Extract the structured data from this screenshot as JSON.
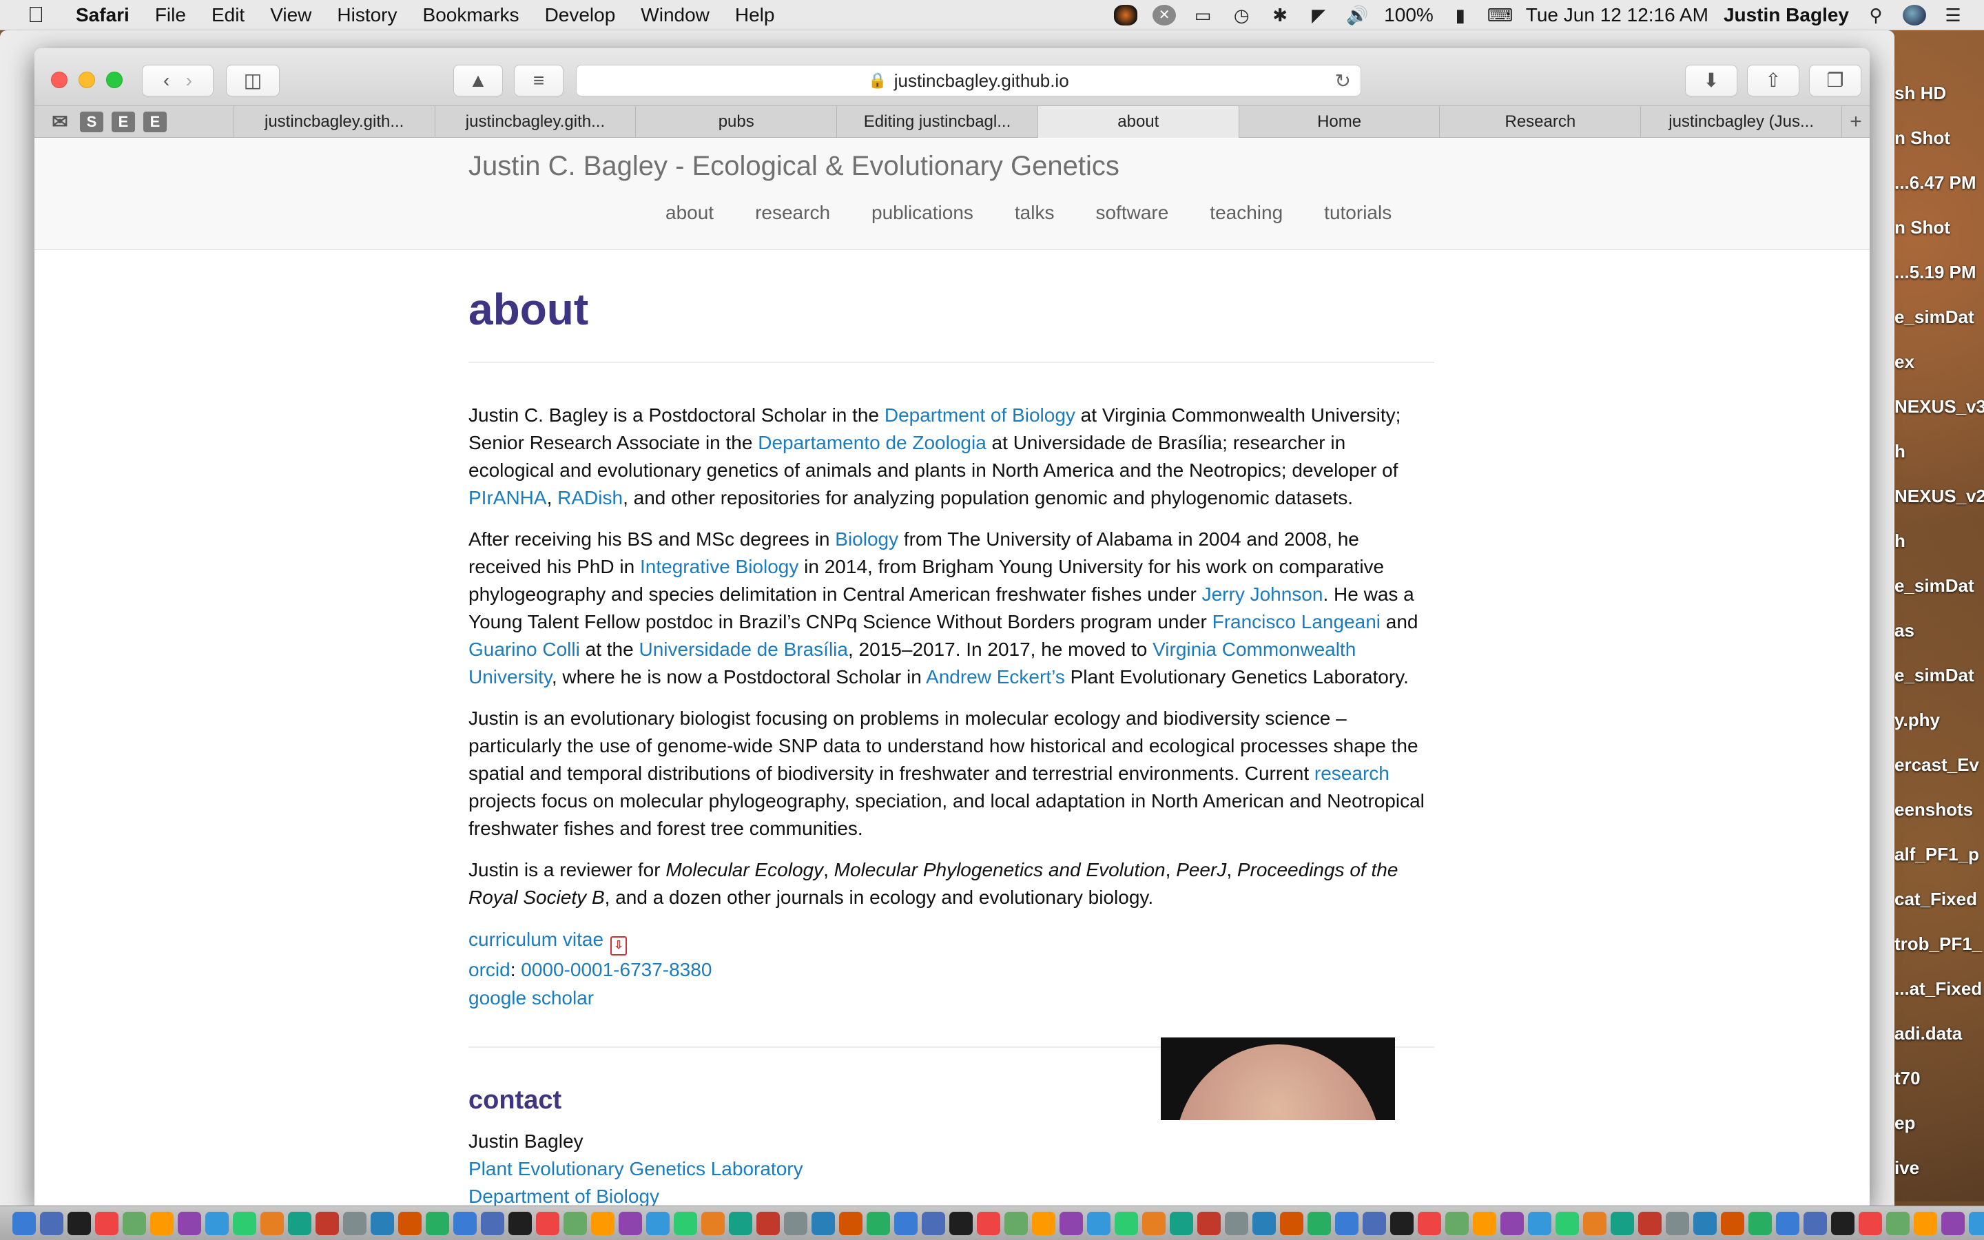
{
  "menubar": {
    "app": "Safari",
    "menus": [
      "File",
      "Edit",
      "View",
      "History",
      "Bookmarks",
      "Develop",
      "Window",
      "Help"
    ],
    "battery": "100%",
    "clock": "Tue Jun 12  12:16 AM",
    "user": "Justin Bagley"
  },
  "desktop_files": [
    {
      "label": "sh HD"
    },
    {
      "label": "n Shot"
    },
    {
      "label": "...6.47 PM"
    },
    {
      "label": "n Shot"
    },
    {
      "label": "...5.19 PM"
    },
    {
      "label": "e_simDat"
    },
    {
      "label": "ex"
    },
    {
      "label": "NEXUS_v3"
    },
    {
      "label": "h"
    },
    {
      "label": "NEXUS_v2"
    },
    {
      "label": "h"
    },
    {
      "label": "e_simDat"
    },
    {
      "label": "as"
    },
    {
      "label": "e_simDat"
    },
    {
      "label": "y.phy"
    },
    {
      "label": "ercast_Ev"
    },
    {
      "label": "eenshots"
    },
    {
      "label": "alf_PF1_p"
    },
    {
      "label": "cat_Fixed"
    },
    {
      "label": "trob_PF1_"
    },
    {
      "label": "...at_Fixed"
    },
    {
      "label": "adi.data"
    },
    {
      "label": "t70"
    },
    {
      "label": "ep"
    },
    {
      "label": "ive"
    }
  ],
  "browser": {
    "url": "justincbagley.github.io",
    "pinned_tabs": [
      "S",
      "E",
      "E"
    ],
    "tabs": [
      {
        "label": "justincbagley.gith...",
        "active": false
      },
      {
        "label": "justincbagley.gith...",
        "active": false
      },
      {
        "label": "pubs",
        "active": false
      },
      {
        "label": "Editing justincbagl...",
        "active": false
      },
      {
        "label": "about",
        "active": true
      },
      {
        "label": "Home",
        "active": false
      },
      {
        "label": "Research",
        "active": false
      },
      {
        "label": "justincbagley (Jus...",
        "active": false
      }
    ]
  },
  "site": {
    "title": "Justin C. Bagley - Ecological & Evolutionary Genetics",
    "nav": [
      "about",
      "research",
      "publications",
      "talks",
      "software",
      "teaching",
      "tutorials"
    ]
  },
  "about": {
    "heading": "about",
    "p1": {
      "t1": "Justin C. Bagley is a Postdoctoral Scholar in the ",
      "l1": "Department of Biology",
      "t2": " at Virginia Commonwealth University; Senior Research Associate in the ",
      "l2": "Departamento de Zoologia",
      "t3": " at Universidade de Brasília; researcher in ecological and evolutionary genetics of animals and plants in North America and the Neotropics; developer of ",
      "l3": "PIrANHA",
      "t4": ", ",
      "l4": "RADish",
      "t5": ", and other repositories for analyzing population genomic and phylogenomic datasets."
    },
    "p2": {
      "t1": "After receiving his BS and MSc degrees in ",
      "l1": "Biology",
      "t2": " from The University of Alabama in 2004 and 2008, he received his PhD in ",
      "l2": "Integrative Biology",
      "t3": " in 2014, from Brigham Young University for his work on comparative phylogeography and species delimitation in Central American freshwater fishes under ",
      "l3": "Jerry Johnson",
      "t4": ". He was a Young Talent Fellow postdoc in Brazil’s CNPq Science Without Borders program under ",
      "l4": "Francisco Langeani",
      "t5": " and ",
      "l5": "Guarino Colli",
      "t6": " at the ",
      "l6": "Universidade de Brasília",
      "t7": ", 2015–2017. In 2017, he moved to ",
      "l7": "Virginia Commonwealth University",
      "t8": ", where he is now a Postdoctoral Scholar in ",
      "l8": "Andrew Eckert’s",
      "t9": " Plant Evolutionary Genetics Laboratory."
    },
    "p3": {
      "t1": "Justin is an evolutionary biologist focusing on problems in molecular ecology and biodiversity science – particularly the use of genome-wide SNP data to understand how historical and ecological processes shape the spatial and temporal distributions of biodiversity in freshwater and terrestrial environments. Current ",
      "l1": "research",
      "t2": " projects focus on molecular phylogeography, speciation, and local adaptation in North American and Neotropical freshwater fishes and forest tree communities."
    },
    "p4": {
      "t1": "Justin is a reviewer for ",
      "e1": "Molecular Ecology",
      "t2": ", ",
      "e2": "Molecular Phylogenetics and Evolution",
      "t3": ", ",
      "e3": "PeerJ",
      "t4": ", ",
      "e4": "Proceedings of the Royal Society B",
      "t5": ", and a dozen other journals in ecology and evolutionary biology."
    },
    "links": {
      "cv": "curriculum vitae",
      "orcid_label": "orcid",
      "orcid_sep": ": ",
      "orcid_id": "0000-0001-6737-8380",
      "scholar": "google scholar"
    },
    "contact": {
      "heading": "contact",
      "name": "Justin Bagley",
      "lab": "Plant Evolutionary Genetics Laboratory",
      "dept": "Department of Biology"
    }
  }
}
